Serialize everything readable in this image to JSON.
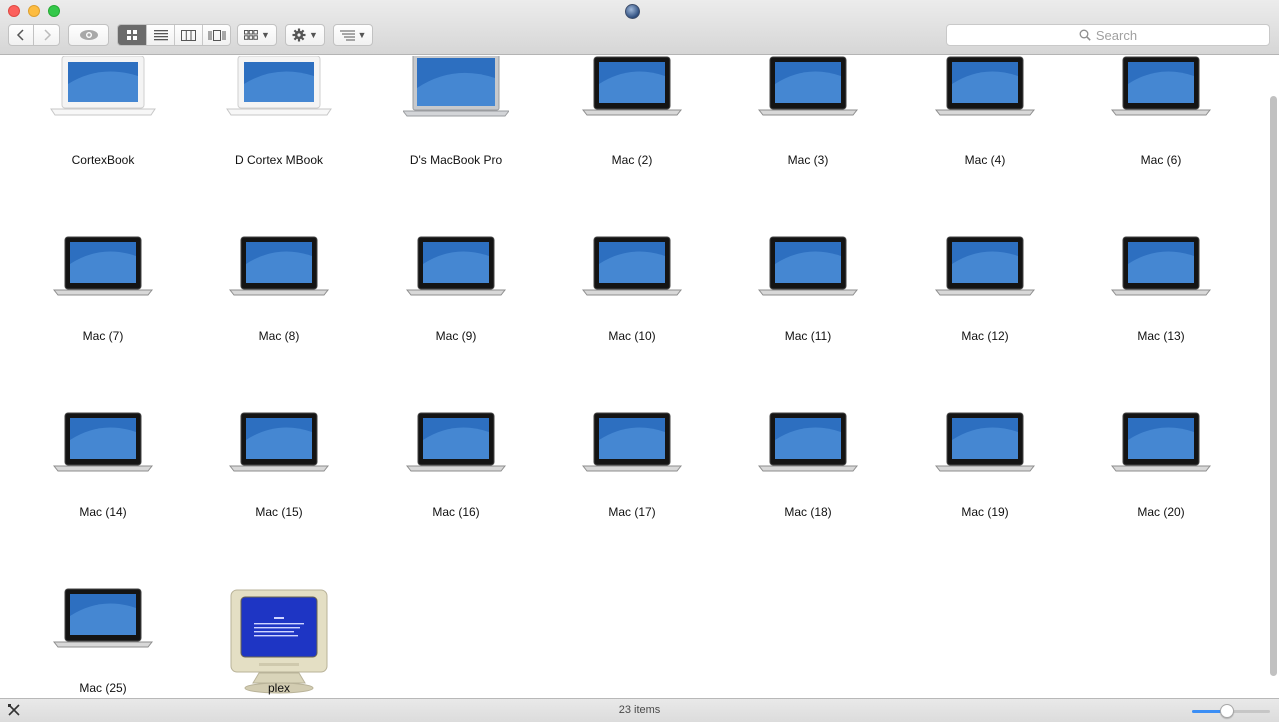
{
  "toolbar": {
    "search_placeholder": "Search",
    "back_icon": "chevron-left-icon",
    "forward_icon": "chevron-right-icon",
    "view_modes": [
      "icon-view",
      "list-view",
      "column-view",
      "cover-flow-view"
    ],
    "selected_view": "icon-view"
  },
  "items": [
    {
      "label": "CortexBook",
      "icon": "white-macbook"
    },
    {
      "label": "D Cortex MBook",
      "icon": "white-macbook"
    },
    {
      "label": "D's MacBook Pro",
      "icon": "silver-macbook-pro"
    },
    {
      "label": "Mac (2)",
      "icon": "macbook"
    },
    {
      "label": "Mac (3)",
      "icon": "macbook"
    },
    {
      "label": "Mac (4)",
      "icon": "macbook"
    },
    {
      "label": "Mac (6)",
      "icon": "macbook"
    },
    {
      "label": "Mac (7)",
      "icon": "macbook"
    },
    {
      "label": "Mac (8)",
      "icon": "macbook"
    },
    {
      "label": "Mac (9)",
      "icon": "macbook"
    },
    {
      "label": "Mac (10)",
      "icon": "macbook"
    },
    {
      "label": "Mac (11)",
      "icon": "macbook"
    },
    {
      "label": "Mac (12)",
      "icon": "macbook"
    },
    {
      "label": "Mac (13)",
      "icon": "macbook"
    },
    {
      "label": "Mac (14)",
      "icon": "macbook"
    },
    {
      "label": "Mac (15)",
      "icon": "macbook"
    },
    {
      "label": "Mac (16)",
      "icon": "macbook"
    },
    {
      "label": "Mac (17)",
      "icon": "macbook"
    },
    {
      "label": "Mac (18)",
      "icon": "macbook"
    },
    {
      "label": "Mac (19)",
      "icon": "macbook"
    },
    {
      "label": "Mac (20)",
      "icon": "macbook"
    },
    {
      "label": "Mac (25)",
      "icon": "macbook"
    },
    {
      "label": "plex",
      "icon": "crt-monitor-bsod"
    }
  ],
  "status": {
    "count": "23 items",
    "icon_size_fraction": 0.45
  },
  "colors": {
    "accent": "#3b8ef5",
    "screen_blue": "#2d6fc0"
  }
}
